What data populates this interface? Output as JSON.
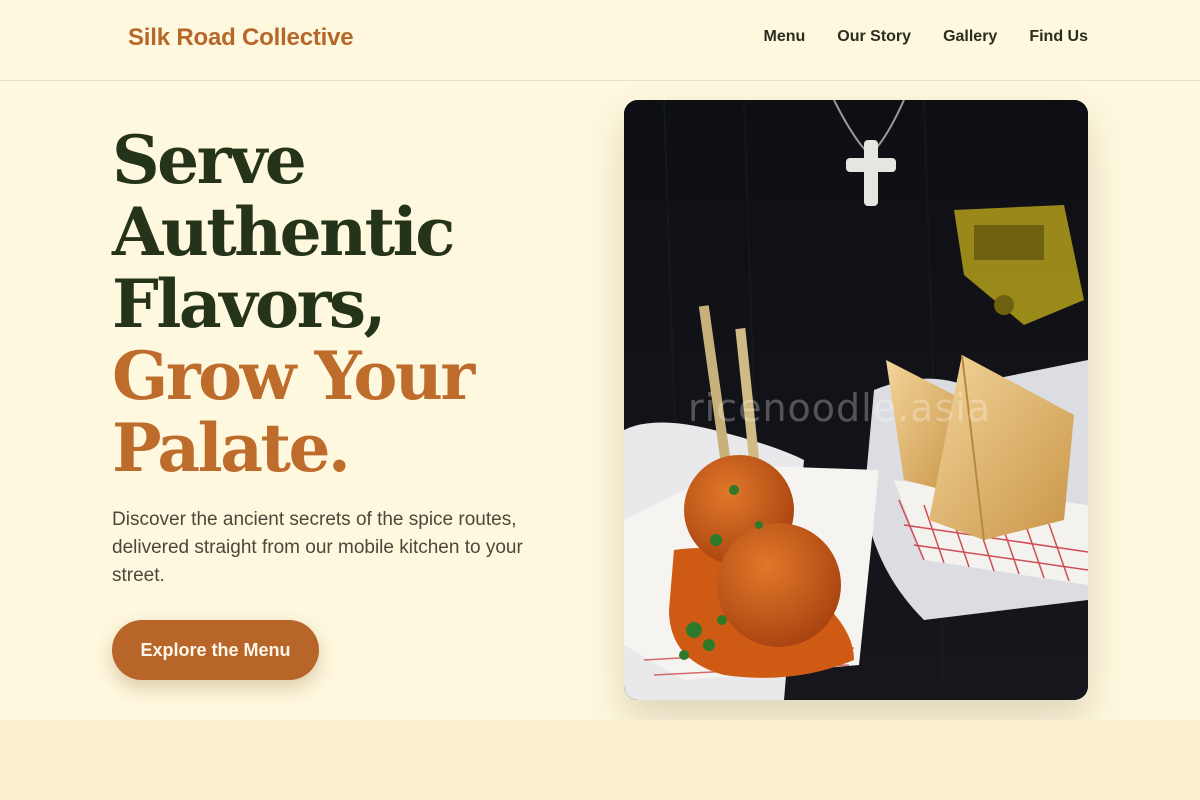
{
  "header": {
    "logo": "Silk Road Collective",
    "nav": [
      "Menu",
      "Our Story",
      "Gallery",
      "Find Us"
    ]
  },
  "hero": {
    "title_dark_lines": [
      "Serve",
      "Authentic",
      "Flavors,"
    ],
    "title_accent_lines": [
      "Grow Your",
      "Palate."
    ],
    "subtext": "Discover the ancient secrets of the spice routes, delivered straight from our mobile kitchen to your street.",
    "cta_label": "Explore the Menu"
  },
  "photo": {
    "watermark": "ricenoodle.asia"
  },
  "colors": {
    "background": "#fef8de",
    "brand": "#b8672a",
    "heading_dark": "#253319",
    "heading_accent": "#bd6c2c",
    "button": "#b8652a"
  }
}
